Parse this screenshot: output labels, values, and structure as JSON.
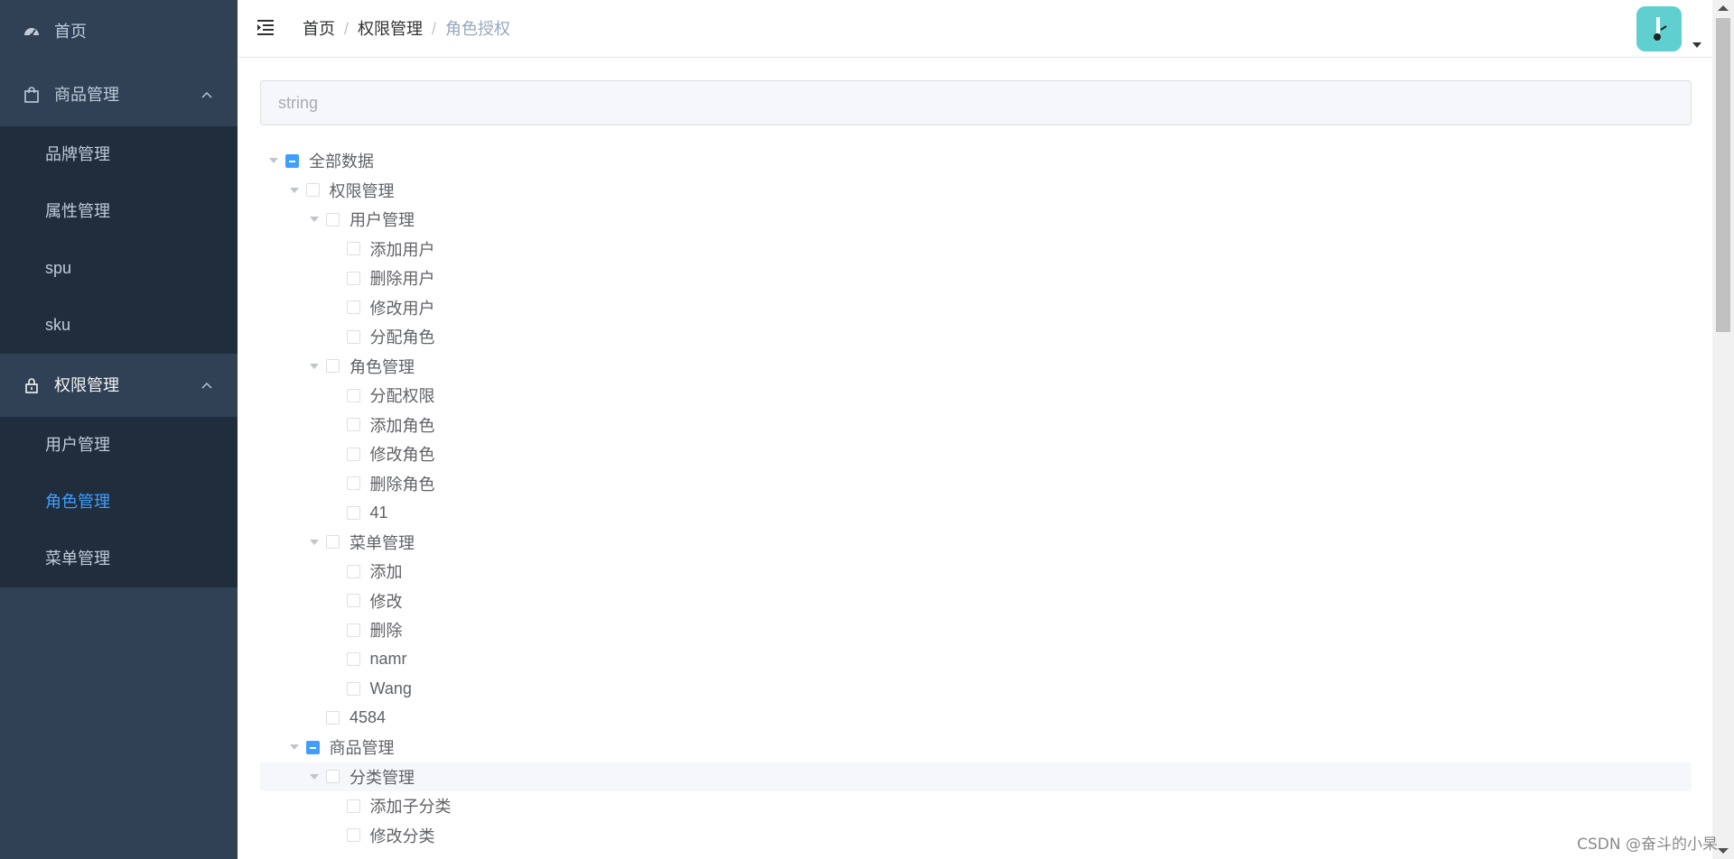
{
  "sidebar": {
    "home": "首页",
    "goods_group": "商品管理",
    "goods_items": [
      "品牌管理",
      "属性管理",
      "spu",
      "sku"
    ],
    "perm_group": "权限管理",
    "perm_items": [
      "用户管理",
      "角色管理",
      "菜单管理"
    ],
    "active_item": "角色管理"
  },
  "header": {
    "breadcrumb": [
      "首页",
      "权限管理",
      "角色授权"
    ],
    "separator": "/"
  },
  "search": {
    "placeholder": "string",
    "value": ""
  },
  "tree": [
    {
      "label": "全部数据",
      "level": 0,
      "expanded": true,
      "state": "indeterminate"
    },
    {
      "label": "权限管理",
      "level": 1,
      "expanded": true,
      "state": "unchecked"
    },
    {
      "label": "用户管理",
      "level": 2,
      "expanded": true,
      "state": "unchecked"
    },
    {
      "label": "添加用户",
      "level": 3,
      "leaf": true,
      "state": "unchecked"
    },
    {
      "label": "删除用户",
      "level": 3,
      "leaf": true,
      "state": "unchecked"
    },
    {
      "label": "修改用户",
      "level": 3,
      "leaf": true,
      "state": "unchecked"
    },
    {
      "label": "分配角色",
      "level": 3,
      "leaf": true,
      "state": "unchecked"
    },
    {
      "label": "角色管理",
      "level": 2,
      "expanded": true,
      "state": "unchecked"
    },
    {
      "label": "分配权限",
      "level": 3,
      "leaf": true,
      "state": "unchecked"
    },
    {
      "label": "添加角色",
      "level": 3,
      "leaf": true,
      "state": "unchecked"
    },
    {
      "label": "修改角色",
      "level": 3,
      "leaf": true,
      "state": "unchecked"
    },
    {
      "label": "删除角色",
      "level": 3,
      "leaf": true,
      "state": "unchecked"
    },
    {
      "label": "41",
      "level": 3,
      "leaf": true,
      "state": "unchecked"
    },
    {
      "label": "菜单管理",
      "level": 2,
      "expanded": true,
      "state": "unchecked"
    },
    {
      "label": "添加",
      "level": 3,
      "leaf": true,
      "state": "unchecked"
    },
    {
      "label": "修改",
      "level": 3,
      "leaf": true,
      "state": "unchecked"
    },
    {
      "label": "删除",
      "level": 3,
      "leaf": true,
      "state": "unchecked"
    },
    {
      "label": "namr",
      "level": 3,
      "leaf": true,
      "state": "unchecked"
    },
    {
      "label": "Wang",
      "level": 3,
      "leaf": true,
      "state": "unchecked"
    },
    {
      "label": "4584",
      "level": 2,
      "leaf": true,
      "state": "unchecked"
    },
    {
      "label": "商品管理",
      "level": 1,
      "expanded": true,
      "state": "indeterminate"
    },
    {
      "label": "分类管理",
      "level": 2,
      "expanded": true,
      "state": "unchecked",
      "highlight": true
    },
    {
      "label": "添加子分类",
      "level": 3,
      "leaf": true,
      "state": "unchecked"
    },
    {
      "label": "修改分类",
      "level": 3,
      "leaf": true,
      "state": "unchecked"
    }
  ],
  "watermark": "CSDN @奋斗的小杲",
  "colors": {
    "sidebar_bg": "#304156",
    "submenu_bg": "#1f2d3d",
    "active": "#409eff",
    "avatar_bg": "#5fd0cf"
  }
}
